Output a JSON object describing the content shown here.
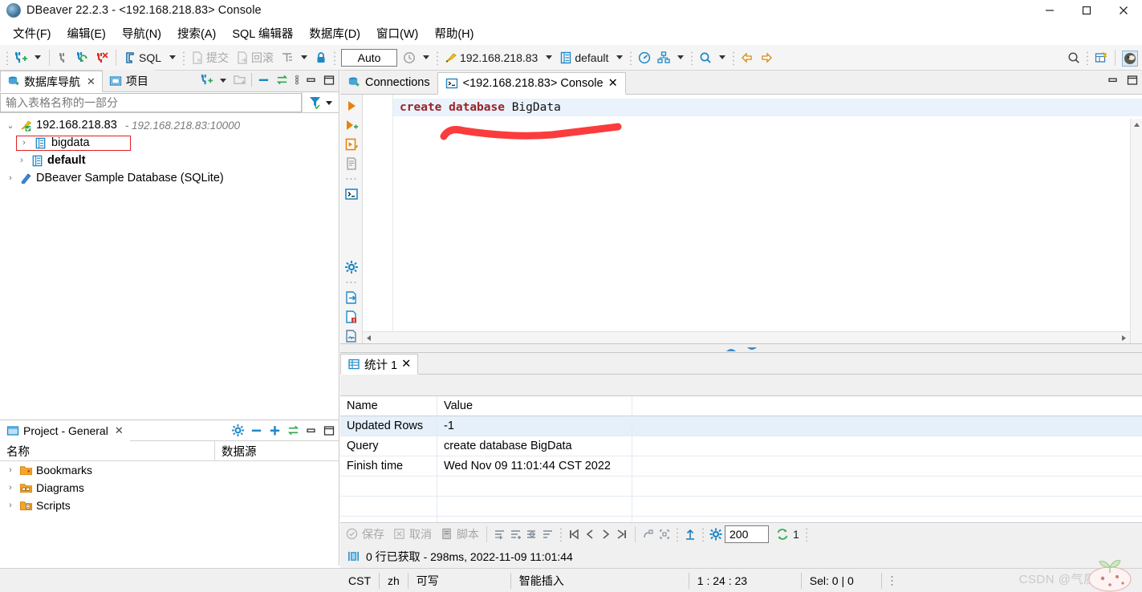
{
  "window": {
    "title": "DBeaver 22.2.3 - <192.168.218.83> Console",
    "minimize": "—",
    "maximize": "☐",
    "close": "✕"
  },
  "menubar": {
    "items": [
      {
        "label": "文件(F)"
      },
      {
        "label": "编辑(E)"
      },
      {
        "label": "导航(N)"
      },
      {
        "label": "搜索(A)"
      },
      {
        "label": "SQL 编辑器"
      },
      {
        "label": "数据库(D)"
      },
      {
        "label": "窗口(W)"
      },
      {
        "label": "帮助(H)"
      }
    ]
  },
  "toolbar": {
    "sql_label": "SQL",
    "commit_label": "提交",
    "rollback_label": "回滚",
    "auto_value": "Auto",
    "connection_value": "192.168.218.83",
    "database_value": "default",
    "icons": {
      "new_connection": "new-connection-icon",
      "disconnect": "disconnect-icon",
      "refresh_connection": "refresh-connection-icon",
      "disconnect_all": "disconnect-all-icon",
      "sql_editor": "sql-editor-icon",
      "commit": "commit-icon",
      "rollback": "rollback-icon",
      "transaction_mode": "transaction-mode-icon",
      "lock": "lock-icon",
      "history": "history-icon",
      "connection": "connection-plug-icon",
      "schema": "schema-icon",
      "dashboard": "dashboard-icon",
      "diagram": "diagram-icon",
      "search": "search-icon",
      "back": "back-arrow-icon",
      "forward": "forward-arrow-icon",
      "global_search": "global-search-icon",
      "new_object": "new-object-icon",
      "perspective": "perspective-avatar-icon"
    }
  },
  "navigator": {
    "tabs": [
      {
        "label": "数据库导航",
        "icon": "database-navigator-icon",
        "active": true,
        "closable": true
      },
      {
        "label": "项目",
        "icon": "project-folder-icon",
        "active": false,
        "closable": false
      }
    ],
    "tools": [
      "new-connection-icon",
      "chevron-down-icon",
      "new-folder-icon",
      "collapse-all-icon",
      "link-editor-icon",
      "view-menu-icon",
      "minimize-icon",
      "maximize-icon"
    ],
    "filter_placeholder": "输入表格名称的一部分",
    "filter_icons": [
      "filter-icon",
      "chevron-down-icon"
    ],
    "tree": [
      {
        "label": "192.168.218.83",
        "sublabel": "- 192.168.218.83:10000",
        "icon": "connection-active-icon",
        "expanded": true,
        "level": 0,
        "bold": false,
        "highlighted": false
      },
      {
        "label": "bigdata",
        "sublabel": "",
        "icon": "database-icon",
        "expanded": false,
        "level": 1,
        "bold": false,
        "highlighted": true
      },
      {
        "label": "default",
        "sublabel": "",
        "icon": "database-icon",
        "expanded": false,
        "level": 1,
        "bold": true,
        "highlighted": false
      },
      {
        "label": "DBeaver Sample Database (SQLite)",
        "sublabel": "",
        "icon": "sqlite-icon",
        "expanded": false,
        "level": 0,
        "bold": false,
        "highlighted": false
      }
    ]
  },
  "project_panel": {
    "tab_label": "Project - General",
    "tab_icon": "project-icon",
    "tools": [
      "gear-icon",
      "collapse-all-icon",
      "expand-all-icon",
      "link-editor-icon",
      "minimize-icon",
      "maximize-icon"
    ],
    "columns": [
      "名称",
      "数据源"
    ],
    "rows": [
      {
        "label": "Bookmarks",
        "icon": "bookmarks-folder-icon",
        "datasource": ""
      },
      {
        "label": "Diagrams",
        "icon": "diagrams-folder-icon",
        "datasource": ""
      },
      {
        "label": "Scripts",
        "icon": "scripts-folder-icon",
        "datasource": ""
      }
    ]
  },
  "editor": {
    "tabs": [
      {
        "label": "Connections",
        "icon": "connections-icon",
        "active": false,
        "closable": false
      },
      {
        "label": "<192.168.218.83> Console",
        "icon": "console-icon",
        "active": true,
        "closable": true
      }
    ],
    "vertical_toolbar": [
      "execute-statement-icon",
      "execute-script-icon",
      "execute-new-tab-icon",
      "execute-script-file-icon",
      "console-icon",
      "gear-icon",
      "export-data-icon",
      "save-file-icon",
      "load-file-icon"
    ],
    "sql_tokens": [
      {
        "text": "create",
        "type": "keyword"
      },
      {
        "text": " ",
        "type": "plain"
      },
      {
        "text": "database",
        "type": "keyword"
      },
      {
        "text": " BigData",
        "type": "plain"
      }
    ],
    "sql_text": "create database BigData",
    "annotation": "red-underline-annotation"
  },
  "results": {
    "tabs": [
      {
        "label": "统计 1",
        "icon": "statistics-grid-icon",
        "active": true,
        "closable": true
      }
    ],
    "columns": [
      "Name",
      "Value"
    ],
    "rows": [
      {
        "name": "Updated Rows",
        "value": "-1",
        "selected": true
      },
      {
        "name": "Query",
        "value": "create database BigData",
        "selected": false
      },
      {
        "name": "Finish time",
        "value": "Wed Nov 09 11:01:44 CST 2022",
        "selected": false
      }
    ],
    "empty_rows": 3,
    "footer": {
      "save_label": "保存",
      "cancel_label": "取消",
      "script_label": "脚本",
      "fetch_size": "200",
      "refresh_count": "1",
      "icons": [
        "save-icon",
        "cancel-icon",
        "script-icon",
        "apply-changes-icon",
        "add-row-icon",
        "duplicate-row-icon",
        "delete-row-icon",
        "first-page-icon",
        "previous-page-icon",
        "next-page-icon",
        "last-page-icon",
        "calc-icon",
        "fit-icon",
        "export-icon",
        "gear-icon",
        "refresh-icon"
      ]
    },
    "status": {
      "icon": "rows-fetched-icon",
      "text": "0 行已获取 - 298ms, 2022-11-09 11:01:44"
    }
  },
  "statusbar": {
    "timezone": "CST",
    "language": "zh",
    "writable": "可写",
    "insert_mode": "智能插入",
    "position": "1 : 24 : 23",
    "selection": "Sel: 0 | 0"
  },
  "watermark": {
    "text": "CSDN @气质&未眠"
  },
  "colors": {
    "keyword": "#9b2226",
    "annotation_red": "#fa3c3c",
    "selection_blue": "#e6f0fa",
    "highlight_border": "#e02020",
    "accent_blue": "#1e88c7"
  }
}
